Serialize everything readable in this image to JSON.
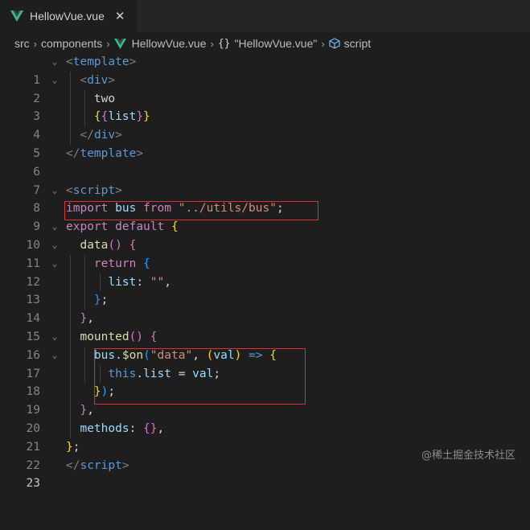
{
  "tab": {
    "title": "HellowVue.vue",
    "close_glyph": "✕",
    "icon": "vue-logo-icon"
  },
  "breadcrumb": {
    "items": [
      "src",
      "components",
      "HellowVue.vue",
      "\"HellowVue.vue\"",
      "script"
    ],
    "separator": "›",
    "braces": "{}"
  },
  "editor": {
    "line_numbers": [
      "1",
      "2",
      "3",
      "4",
      "5",
      "6",
      "7",
      "8",
      "9",
      "10",
      "11",
      "12",
      "13",
      "14",
      "15",
      "16",
      "17",
      "18",
      "19",
      "20",
      "21",
      "22",
      "23"
    ],
    "active_line": "23"
  },
  "watermark": "@稀土掘金技术社区",
  "colors": {
    "background": "#1e1e1e",
    "tag": "#569cd6",
    "keyword": "#c586c0",
    "variable": "#9cdcfe",
    "string": "#ce9178",
    "function": "#dcdcaa",
    "highlight_box": "#e03030",
    "vue_green": "#41b883"
  }
}
